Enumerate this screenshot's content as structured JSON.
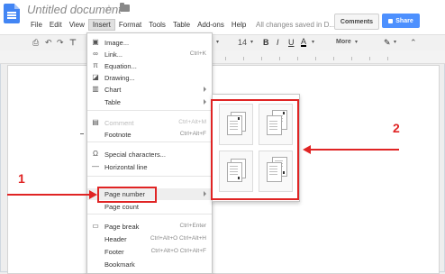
{
  "app": {
    "title": "Untitled document",
    "save_status": "All changes saved in D...",
    "comments_label": "Comments",
    "share_label": "Share"
  },
  "menubar": [
    "File",
    "Edit",
    "View",
    "Insert",
    "Format",
    "Tools",
    "Table",
    "Add-ons",
    "Help"
  ],
  "toolbar": {
    "font_size": "14",
    "more_label": "More"
  },
  "insert_menu": [
    {
      "icon": "image-icon",
      "glyph": "▣",
      "label": "Image...",
      "shortcut": ""
    },
    {
      "icon": "link-icon",
      "glyph": "∞",
      "label": "Link...",
      "shortcut": "Ctrl+K"
    },
    {
      "icon": "equation-icon",
      "glyph": "π",
      "label": "Equation...",
      "shortcut": ""
    },
    {
      "icon": "drawing-icon",
      "glyph": "◪",
      "label": "Drawing...",
      "shortcut": ""
    },
    {
      "icon": "chart-icon",
      "glyph": "▥",
      "label": "Chart",
      "shortcut": "",
      "submenu": true
    },
    {
      "icon": "",
      "glyph": "",
      "label": "Table",
      "shortcut": "",
      "submenu": true
    },
    {
      "icon": "comment-icon",
      "glyph": "▤",
      "label": "Comment",
      "shortcut": "Ctrl+Alt+M",
      "disabled": true
    },
    {
      "icon": "",
      "glyph": "",
      "label": "Footnote",
      "shortcut": "Ctrl+Alt+F"
    },
    {
      "icon": "omega-icon",
      "glyph": "Ω",
      "label": "Special characters...",
      "shortcut": ""
    },
    {
      "icon": "horizontal-line-icon",
      "glyph": "—",
      "label": "Horizontal line",
      "shortcut": ""
    },
    {
      "icon": "",
      "glyph": "",
      "label": "Page number",
      "shortcut": "",
      "submenu": true,
      "active": true
    },
    {
      "icon": "",
      "glyph": "",
      "label": "Page count",
      "shortcut": ""
    },
    {
      "icon": "page-break-icon",
      "glyph": "▭",
      "label": "Page break",
      "shortcut": "Ctrl+Enter"
    },
    {
      "icon": "",
      "glyph": "",
      "label": "Header",
      "shortcut": "Ctrl+Alt+O Ctrl+Alt+H"
    },
    {
      "icon": "",
      "glyph": "",
      "label": "Footer",
      "shortcut": "Ctrl+Alt+O Ctrl+Alt+F"
    },
    {
      "icon": "",
      "glyph": "",
      "label": "Bookmark",
      "shortcut": ""
    }
  ],
  "annotations": {
    "step1": "1",
    "step2": "2"
  },
  "colors": {
    "accent_red": "#e02424",
    "share_blue": "#4d90fe",
    "docs_blue": "#4285f4"
  }
}
